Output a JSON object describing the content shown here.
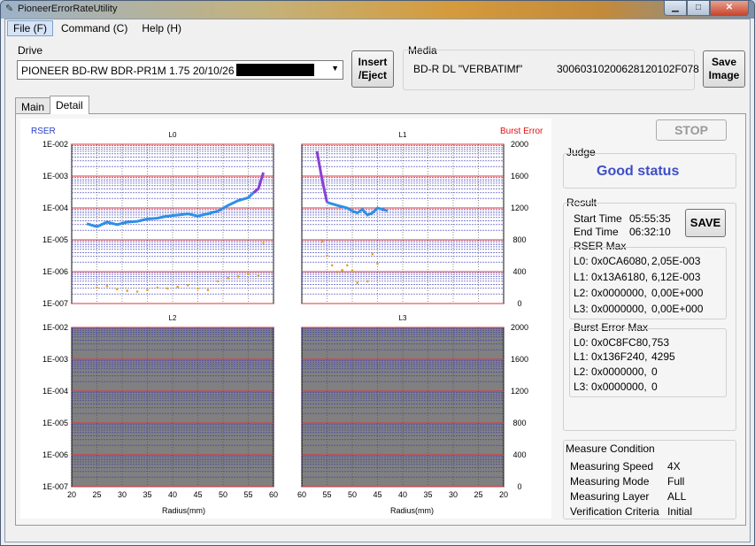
{
  "window": {
    "title": "PioneerErrorRateUtility",
    "minimize": "▁",
    "maximize": "□",
    "close": "✕"
  },
  "menu": {
    "file": "File (F)",
    "command": "Command (C)",
    "help": "Help (H)"
  },
  "drive": {
    "label": "Drive",
    "value": "PIONEER BD-RW BDR-PR1M  1.75 20/10/26"
  },
  "buttons": {
    "insert_line1": "Insert",
    "insert_line2": "/Eject",
    "save_image_line1": "Save",
    "save_image_line2": "Image",
    "stop": "STOP",
    "save": "SAVE"
  },
  "media": {
    "label": "Media",
    "type": "BD-R DL \"VERBATIMf\"",
    "id": "30060310200628120102F078"
  },
  "tabs": {
    "main": "Main",
    "detail": "Detail"
  },
  "judge": {
    "label": "Judge",
    "value": "Good status"
  },
  "result": {
    "label": "Result",
    "start_label": "Start Time",
    "start_value": "05:55:35",
    "end_label": "End Time",
    "end_value": "06:32:10",
    "rser_max_label": "RSER Max",
    "rser_max": [
      {
        "layer": "L0: 0x0CA6080,",
        "value": "2,05E-003"
      },
      {
        "layer": "L1: 0x13A6180,",
        "value": "6,12E-003"
      },
      {
        "layer": "L2: 0x0000000,",
        "value": "0,00E+000"
      },
      {
        "layer": "L3: 0x0000000,",
        "value": "0,00E+000"
      }
    ],
    "burst_max_label": "Burst Error Max",
    "burst_max": [
      {
        "layer": "L0: 0x0C8FC80,",
        "value": "753"
      },
      {
        "layer": "L1: 0x136F240,",
        "value": "4295"
      },
      {
        "layer": "L2: 0x0000000,",
        "value": "0"
      },
      {
        "layer": "L3: 0x0000000,",
        "value": "0"
      }
    ]
  },
  "measure": {
    "label": "Measure Condition",
    "rows": [
      {
        "k": "Measuring Speed",
        "v": "4X"
      },
      {
        "k": "Measuring Mode",
        "v": "Full"
      },
      {
        "k": "Measuring Layer",
        "v": "ALL"
      },
      {
        "k": "Verification Criteria",
        "v": "Initial"
      }
    ]
  },
  "colors": {
    "rser_line": "#2f8fe6",
    "rser_peak": "#8a3fd6",
    "burst_dots": "#e8a21a",
    "grid_red": "#e0303a",
    "grid_blue": "#3b3bb8",
    "empty_fill": "#808080",
    "judge_text": "#3e4fc7"
  },
  "chart_data": {
    "type": "line",
    "left_axis_label": "RSER",
    "right_axis_label": "Burst Error",
    "y_left_ticks": [
      "1E-002",
      "1E-003",
      "1E-004",
      "1E-005",
      "1E-006",
      "1E-007"
    ],
    "y_right_ticks": [
      "2000",
      "1600",
      "1200",
      "800",
      "400",
      "0"
    ],
    "xlabel": "Radius(mm)",
    "panels": [
      {
        "name": "L0",
        "x_ticks": [
          "20",
          "25",
          "30",
          "35",
          "40",
          "45",
          "50",
          "55",
          "60"
        ],
        "xlim": [
          20,
          60
        ],
        "rser": {
          "x": [
            23,
            25,
            27,
            29,
            31,
            33,
            35,
            37,
            39,
            41,
            43,
            45,
            47,
            49,
            51,
            53,
            55,
            56,
            57,
            58
          ],
          "y": [
            3.2e-05,
            2.6e-05,
            3.6e-05,
            3e-05,
            3.6e-05,
            3.8e-05,
            4.5e-05,
            4.8e-05,
            5.6e-05,
            6e-05,
            6.5e-05,
            5.6e-05,
            6.6e-05,
            8e-05,
            0.00012,
            0.00017,
            0.00021,
            0.0003,
            0.0004,
            0.0013
          ]
        },
        "burst": {
          "x": [
            25,
            27,
            29,
            31,
            33,
            35,
            37,
            39,
            41,
            43,
            45,
            47,
            49,
            51,
            53,
            55,
            57,
            58
          ],
          "y": [
            200,
            220,
            180,
            160,
            150,
            170,
            200,
            190,
            210,
            230,
            190,
            170,
            280,
            320,
            340,
            370,
            350,
            760
          ]
        }
      },
      {
        "name": "L1",
        "x_ticks": [
          "60",
          "55",
          "50",
          "45",
          "40",
          "35",
          "30",
          "25",
          "20"
        ],
        "xlim": [
          60,
          20
        ],
        "rser": {
          "x": [
            57,
            56,
            55,
            53,
            51,
            50,
            49,
            48,
            47,
            46,
            45,
            44,
            43
          ],
          "y": [
            0.006,
            0.0008,
            0.00015,
            0.00012,
            0.0001,
            8e-05,
            7e-05,
            9e-05,
            6e-05,
            7e-05,
            0.0001,
            9e-05,
            8e-05
          ]
        },
        "burst": {
          "x": [
            56,
            55,
            54,
            53,
            52,
            51,
            50,
            49,
            47,
            46,
            45
          ],
          "y": [
            780,
            600,
            480,
            400,
            420,
            480,
            410,
            260,
            280,
            620,
            500
          ]
        }
      },
      {
        "name": "L2",
        "x_ticks": [
          "20",
          "25",
          "30",
          "35",
          "40",
          "45",
          "50",
          "55",
          "60"
        ],
        "xlim": [
          20,
          60
        ],
        "rser": {
          "x": [],
          "y": []
        },
        "burst": {
          "x": [],
          "y": []
        }
      },
      {
        "name": "L3",
        "x_ticks": [
          "60",
          "55",
          "50",
          "45",
          "40",
          "35",
          "30",
          "25",
          "20"
        ],
        "xlim": [
          60,
          20
        ],
        "rser": {
          "x": [],
          "y": []
        },
        "burst": {
          "x": [],
          "y": []
        }
      }
    ]
  }
}
